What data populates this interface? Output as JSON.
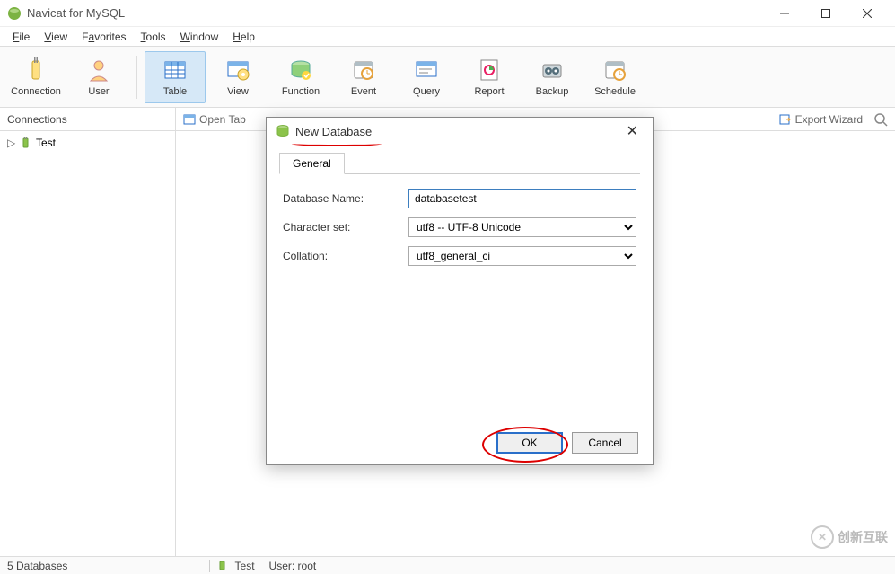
{
  "titlebar": {
    "title": "Navicat for MySQL"
  },
  "menubar": {
    "items": [
      "File",
      "View",
      "Favorites",
      "Tools",
      "Window",
      "Help"
    ]
  },
  "toolbar": {
    "connection": "Connection",
    "user": "User",
    "table": "Table",
    "view": "View",
    "function": "Function",
    "event": "Event",
    "query": "Query",
    "report": "Report",
    "backup": "Backup",
    "schedule": "Schedule"
  },
  "subrow": {
    "connections": "Connections",
    "open_tab": "Open Tab",
    "export_wizard": "Export Wizard"
  },
  "sidebar": {
    "tree_item": "Test"
  },
  "dialog": {
    "title": "New Database",
    "tab_general": "General",
    "label_dbname": "Database Name:",
    "value_dbname": "databasetest",
    "label_charset": "Character set:",
    "value_charset": "utf8 -- UTF-8 Unicode",
    "label_collation": "Collation:",
    "value_collation": "utf8_general_ci",
    "btn_ok": "OK",
    "btn_cancel": "Cancel"
  },
  "statusbar": {
    "left": "5 Databases",
    "conn": "Test",
    "user": "User: root"
  },
  "watermark": {
    "text": "创新互联"
  }
}
